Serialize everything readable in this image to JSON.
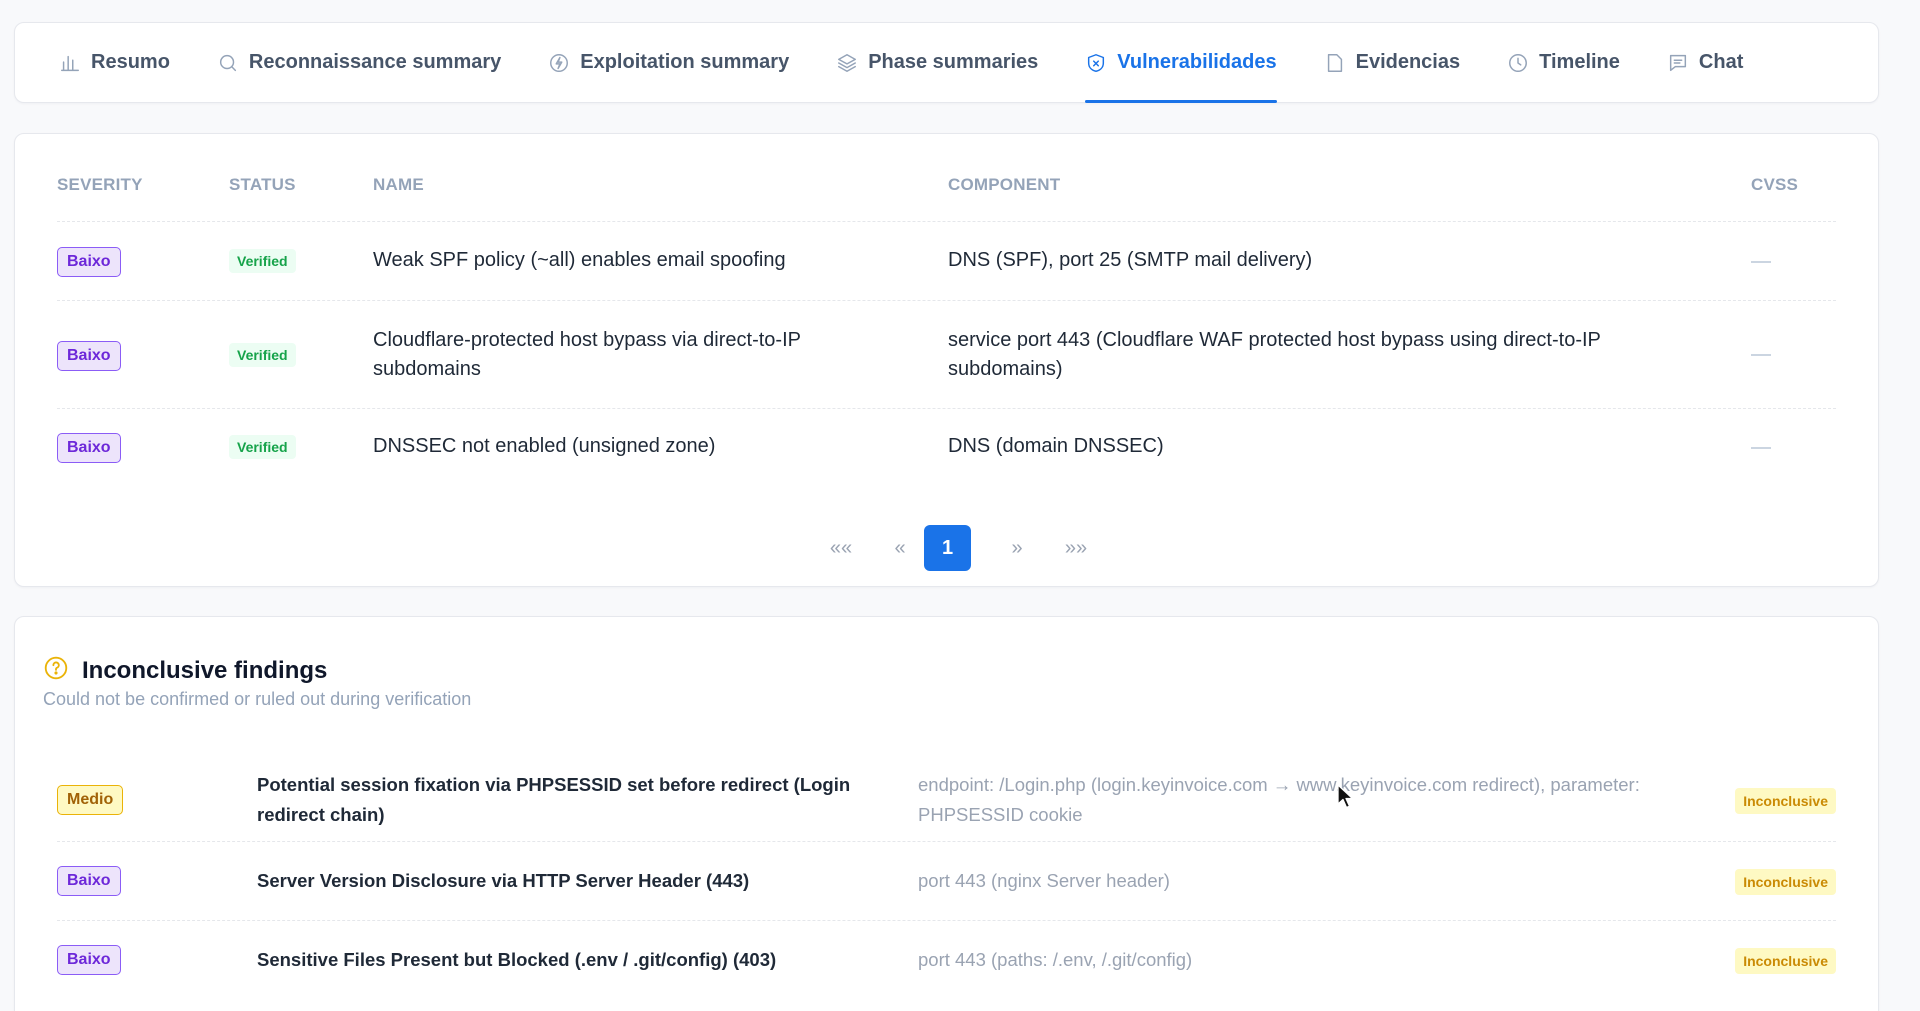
{
  "tabs": [
    {
      "label": "Resumo",
      "icon": "bar-chart-icon",
      "active": false
    },
    {
      "label": "Reconnaissance summary",
      "icon": "search-icon",
      "active": false
    },
    {
      "label": "Exploitation summary",
      "icon": "bolt-circle-icon",
      "active": false
    },
    {
      "label": "Phase summaries",
      "icon": "layers-icon",
      "active": false
    },
    {
      "label": "Vulnerabilidades",
      "icon": "shield-x-icon",
      "active": true
    },
    {
      "label": "Evidencias",
      "icon": "folder-icon",
      "active": false
    },
    {
      "label": "Timeline",
      "icon": "clock-icon",
      "active": false
    },
    {
      "label": "Chat",
      "icon": "chat-icon",
      "active": false
    }
  ],
  "vulns": {
    "headers": {
      "severity": "SEVERITY",
      "status": "STATUS",
      "name": "NAME",
      "component": "COMPONENT",
      "cvss": "CVSS"
    },
    "rows": [
      {
        "severity": "Baixo",
        "status": "Verified",
        "name": "Weak SPF policy (~all) enables email spoofing",
        "component": "DNS (SPF), port 25 (SMTP mail delivery)",
        "cvss": "—"
      },
      {
        "severity": "Baixo",
        "status": "Verified",
        "name_line1": "Cloudflare-protected host bypass via direct-to-IP",
        "name_line2": "subdomains",
        "component_line1": "service port 443 (Cloudflare WAF protected host bypass using direct-to-IP",
        "component_line2": "subdomains)",
        "cvss": "—"
      },
      {
        "severity": "Baixo",
        "status": "Verified",
        "name": "DNSSEC not enabled (unsigned zone)",
        "component": "DNS (domain DNSSEC)",
        "cvss": "—"
      }
    ],
    "pagination": {
      "first": "«« ",
      "prev": "«",
      "current": "1",
      "next": "»",
      "last": "»»"
    }
  },
  "inconclusive": {
    "title": "Inconclusive findings",
    "subtitle": "Could not be confirmed or ruled out during verification",
    "rows": [
      {
        "severity": "Medio",
        "name_line1": "Potential session fixation via PHPSESSID set before redirect (Login",
        "name_line2": "redirect chain)",
        "component_line1": "endpoint: /Login.php (login.keyinvoice.com → www.keyinvoice.com redirect), parameter:",
        "component_line2": "PHPSESSID cookie",
        "badge": "Inconclusive"
      },
      {
        "severity": "Baixo",
        "name": "Server Version Disclosure via HTTP Server Header (443)",
        "component": "port 443 (nginx Server header)",
        "badge": "Inconclusive"
      },
      {
        "severity": "Baixo",
        "name": "Sensitive Files Present but Blocked (.env / .git/config) (403)",
        "component": "port 443 (paths: /.env, /.git/config)",
        "badge": "Inconclusive"
      }
    ]
  },
  "colors": {
    "accent": "#1a73e8",
    "baixo": "#8b5cf6",
    "medio": "#eab308",
    "verified": "#16a34a",
    "inconclusive": "#ca8a04"
  }
}
